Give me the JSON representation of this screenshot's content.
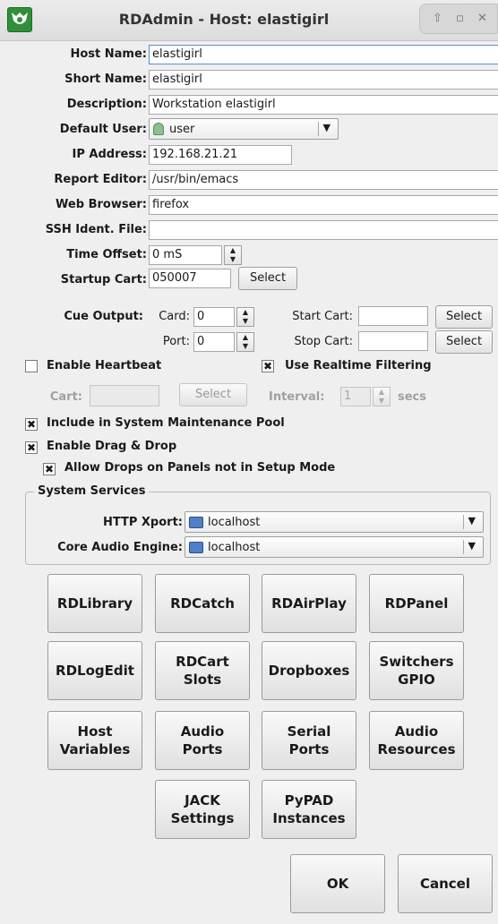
{
  "window": {
    "title": "RDAdmin - Host: elastigirl"
  },
  "labels": {
    "host_name": "Host Name:",
    "short_name": "Short Name:",
    "description": "Description:",
    "default_user": "Default User:",
    "ip_address": "IP Address:",
    "report_editor": "Report Editor:",
    "web_browser": "Web Browser:",
    "ssh_ident_file": "SSH Ident. File:",
    "time_offset": "Time Offset:",
    "startup_cart": "Startup Cart:",
    "cue_output": "Cue Output:",
    "card": "Card:",
    "port": "Port:",
    "start_cart": "Start Cart:",
    "stop_cart": "Stop Cart:",
    "cart": "Cart:",
    "interval": "Interval:",
    "secs": "secs",
    "http_xport": "HTTP Xport:",
    "core_audio_engine": "Core Audio Engine:"
  },
  "fields": {
    "host_name": "elastigirl",
    "short_name": "elastigirl",
    "description": "Workstation elastigirl",
    "default_user": "user",
    "ip_address": "192.168.21.21",
    "report_editor": "/usr/bin/emacs",
    "web_browser": "firefox",
    "ssh_ident_file": "",
    "time_offset": "0 mS",
    "startup_cart": "050007",
    "cue_card": "0",
    "cue_port": "0",
    "start_cart": "",
    "stop_cart": "",
    "heartbeat_cart": "",
    "interval": "1",
    "http_xport": "localhost",
    "core_audio_engine": "localhost"
  },
  "checkboxes": {
    "enable_heartbeat": {
      "label": "Enable Heartbeat",
      "checked": false
    },
    "use_realtime_filtering": {
      "label": "Use Realtime Filtering",
      "checked": true
    },
    "system_maintenance": {
      "label": "Include in System Maintenance Pool",
      "checked": true
    },
    "drag_drop": {
      "label": "Enable Drag & Drop",
      "checked": true
    },
    "allow_drops": {
      "label": "Allow Drops on Panels not in Setup Mode",
      "checked": true
    }
  },
  "buttons": {
    "select": "Select",
    "ok": "OK",
    "cancel": "Cancel"
  },
  "group": {
    "system_services": "System Services"
  },
  "module_buttons": [
    "RDLibrary",
    "RDCatch",
    "RDAirPlay",
    "RDPanel",
    "RDLogEdit",
    "RDCart\nSlots",
    "Dropboxes",
    "Switchers\nGPIO",
    "Host\nVariables",
    "Audio\nPorts",
    "Serial\nPorts",
    "Audio\nResources",
    "JACK\nSettings",
    "PyPAD\nInstances"
  ],
  "icons": {
    "app": "rivendell-logo-icon",
    "user": "user-icon",
    "host": "computer-icon",
    "check_mark": "✖"
  }
}
